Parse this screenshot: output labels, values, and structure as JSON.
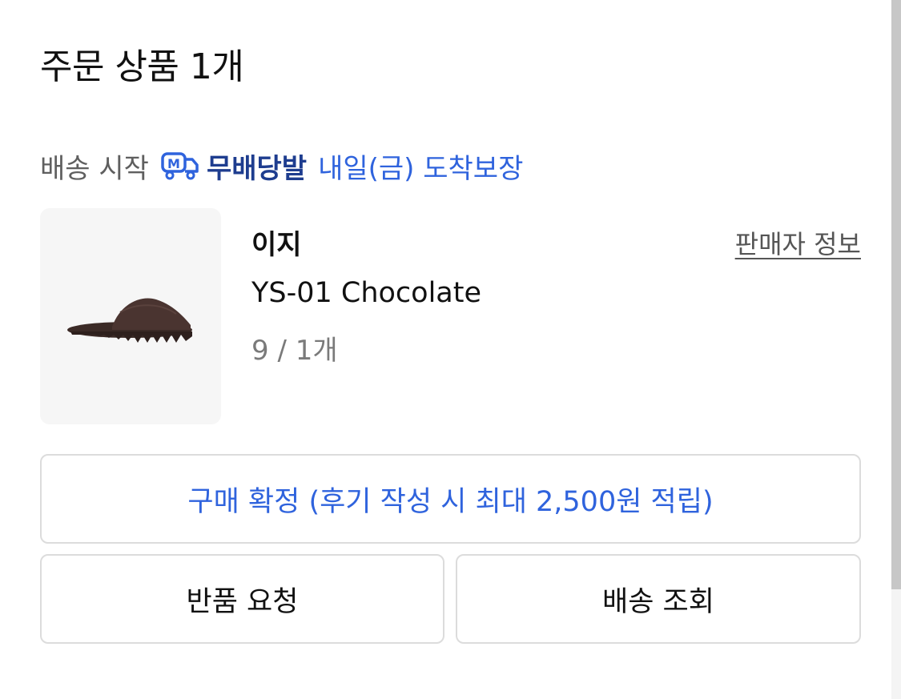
{
  "order": {
    "title": "주문 상품 1개"
  },
  "shipping": {
    "start_label": "배송 시작",
    "service_icon": "delivery-truck-icon",
    "service_name": "무배당발",
    "arrival_text": "내일(금) 도착보장",
    "accent_color": "#2f63dd",
    "service_color": "#1e3d8f"
  },
  "product": {
    "image_icon": "slide-sandal-image",
    "brand": "이지",
    "name": "YS-01 Chocolate",
    "option": "9 / 1개",
    "seller_info_label": "판매자 정보"
  },
  "actions": {
    "confirm_purchase": "구매 확정 (후기 작성 시 최대 2,500원 적립)",
    "return_request": "반품 요청",
    "track_delivery": "배송 조회"
  }
}
